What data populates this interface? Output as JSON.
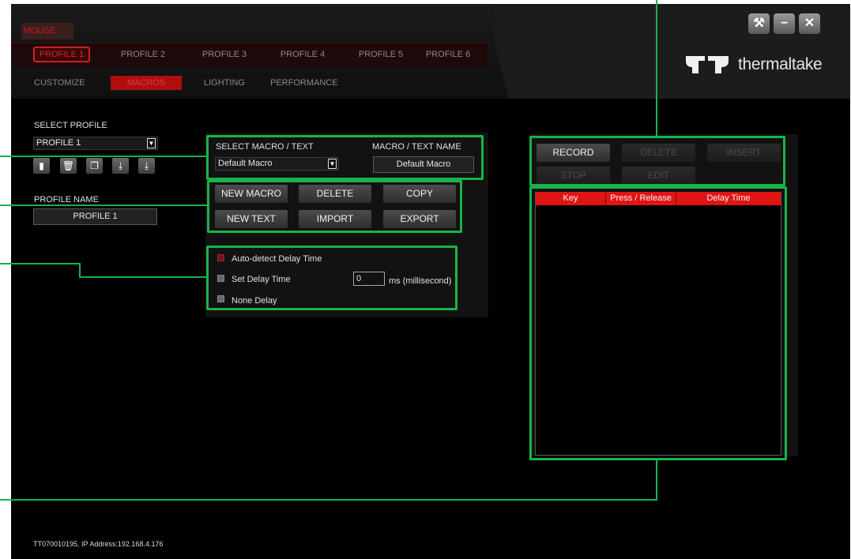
{
  "device_tab": "MOUSE",
  "profile_tabs": [
    "PROFILE 1",
    "PROFILE 2",
    "PROFILE 3",
    "PROFILE 4",
    "PROFILE 5",
    "PROFILE 6"
  ],
  "sub_tabs": [
    "CUSTOMIZE",
    "MACROS",
    "LIGHTING",
    "PERFORMANCE"
  ],
  "brand": "thermaltake",
  "select_profile": {
    "label": "SELECT PROFILE",
    "value": "PROFILE 1"
  },
  "profile_name": {
    "label": "PROFILE NAME",
    "value": "PROFILE 1"
  },
  "macro_select": {
    "label": "SELECT MACRO / TEXT",
    "value": "Default Macro"
  },
  "macro_name": {
    "label": "MACRO / TEXT NAME",
    "value": "Default Macro"
  },
  "macro_buttons": {
    "new_macro": "NEW MACRO",
    "delete": "DELETE",
    "copy": "COPY",
    "new_text": "NEW TEXT",
    "import": "IMPORT",
    "export": "EXPORT"
  },
  "delay": {
    "auto": "Auto-detect Delay Time",
    "set": "Set Delay Time",
    "none": "None Delay",
    "value": "0",
    "unit": "ms (millisecond)",
    "selected": "auto"
  },
  "record_buttons": {
    "record": "RECORD",
    "delete": "DELETE",
    "insert": "INSERT",
    "stop": "STOP",
    "edit": "EDIT"
  },
  "table_columns": [
    "Key",
    "Press / Release",
    "Delay Time"
  ],
  "status_bar": "TT070010195, IP Address:192.168.4.176",
  "colors": {
    "accent_red": "#e11414",
    "highlight_green": "#19b34a",
    "background": "#000000"
  }
}
